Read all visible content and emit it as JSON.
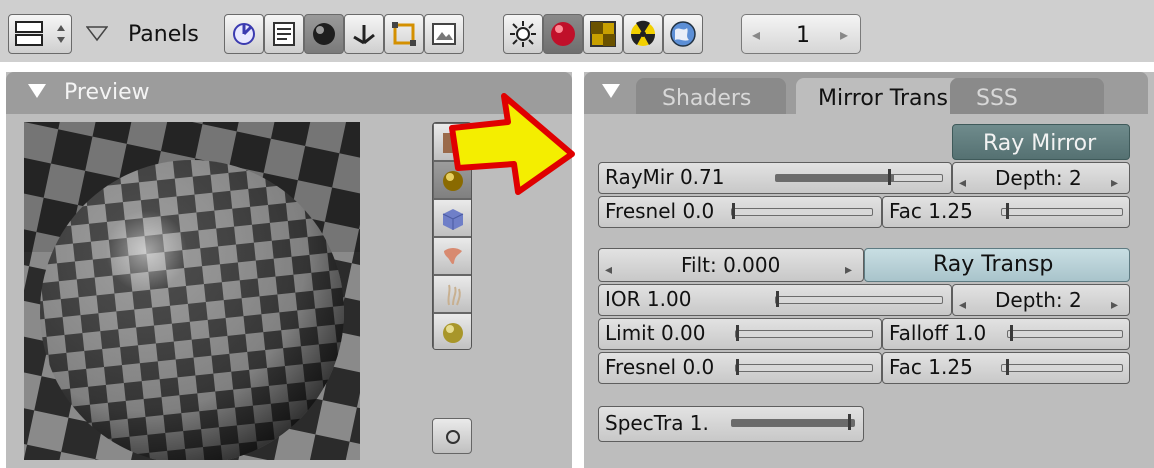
{
  "header": {
    "panels_label": "Panels",
    "frame_number": "1"
  },
  "preview": {
    "title": "Preview"
  },
  "tabs": [
    {
      "label": "Shaders"
    },
    {
      "label": "Mirror Trans"
    },
    {
      "label": "SSS"
    }
  ],
  "mirror": {
    "ray_mirror_label": "Ray Mirror",
    "raymir_label": "RayMir 0.71",
    "raymir_value": 0.71,
    "depth_label": "Depth: 2",
    "fresnel_label": "Fresnel 0.0",
    "fac_label": "Fac 1.25"
  },
  "transp": {
    "filt_label": "Filt: 0.000",
    "ray_transp_label": "Ray Transp",
    "ior_label": "IOR 1.00",
    "depth_label": "Depth: 2",
    "limit_label": "Limit 0.00",
    "falloff_label": "Falloff 1.0",
    "fresnel_label": "Fresnel 0.0",
    "fac_label": "Fac 1.25",
    "spectra_label": "SpecTra 1."
  },
  "colors": {
    "header_bg": "#cfcfcf",
    "panel_bg": "#bdbdbd",
    "title_bar": "#9c9c9c",
    "ray_mirror_button": "#5f7b7c",
    "ray_transp_button": "#b7d0d6",
    "arrow_fill": "#f4ee00",
    "arrow_outline": "#e00000"
  },
  "icons": {
    "material_preview_types": [
      "plane-preview-icon",
      "sphere-preview-icon",
      "cube-preview-icon",
      "monkey-preview-icon",
      "hair-preview-icon",
      "sky-sphere-preview-icon"
    ]
  }
}
